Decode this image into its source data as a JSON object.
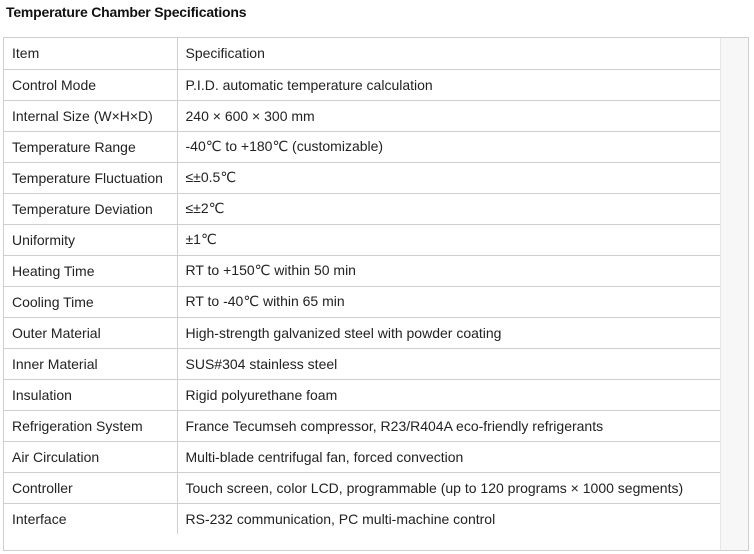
{
  "title": "Temperature Chamber Specifications",
  "table": {
    "headers": [
      "Item",
      "Specification"
    ],
    "rows": [
      [
        "Control Mode",
        "P.I.D. automatic temperature calculation"
      ],
      [
        "Internal Size (W×H×D)",
        "240 × 600 × 300 mm"
      ],
      [
        "Temperature Range",
        "-40℃ to +180℃ (customizable)"
      ],
      [
        "Temperature Fluctuation",
        "≤±0.5℃"
      ],
      [
        "Temperature Deviation",
        "≤±2℃"
      ],
      [
        "Uniformity",
        "±1℃"
      ],
      [
        "Heating Time",
        "RT to +150℃ within 50 min"
      ],
      [
        "Cooling Time",
        "RT to -40℃ within 65 min"
      ],
      [
        "Outer Material",
        "High-strength galvanized steel with powder coating"
      ],
      [
        "Inner Material",
        "SUS#304 stainless steel"
      ],
      [
        "Insulation",
        "Rigid polyurethane foam"
      ],
      [
        "Refrigeration System",
        "France Tecumseh compressor, R23/R404A eco-friendly refrigerants"
      ],
      [
        "Air Circulation",
        "Multi-blade centrifugal fan, forced convection"
      ],
      [
        "Controller",
        "Touch screen, color LCD, programmable (up to 120 programs × 1000 segments)"
      ],
      [
        "Interface",
        "RS-232 communication, PC multi-machine control"
      ]
    ]
  }
}
